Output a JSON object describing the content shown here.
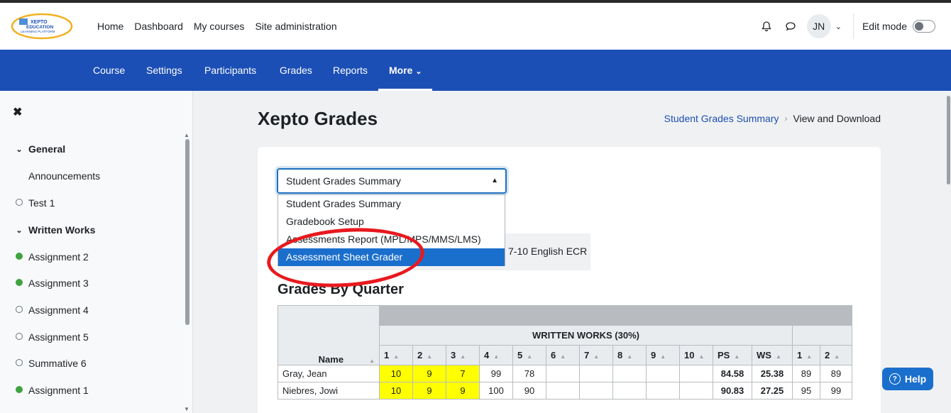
{
  "navbar": {
    "logo_text": "XEPTO EDUCATION LEARNING PLATFORM",
    "links": [
      "Home",
      "Dashboard",
      "My courses",
      "Site administration"
    ],
    "avatar_initials": "JN",
    "edit_mode_label": "Edit mode"
  },
  "secondary_nav": {
    "items": [
      "Course",
      "Settings",
      "Participants",
      "Grades",
      "Reports"
    ],
    "more_label": "More"
  },
  "drawer": {
    "items": [
      {
        "label": "General",
        "type": "section"
      },
      {
        "label": "Announcements",
        "type": "plain"
      },
      {
        "label": "Test 1",
        "type": "todo"
      },
      {
        "label": "Written Works",
        "type": "section"
      },
      {
        "label": "Assignment 2",
        "type": "done"
      },
      {
        "label": "Assignment 3",
        "type": "done"
      },
      {
        "label": "Assignment 4",
        "type": "todo"
      },
      {
        "label": "Assignment 5",
        "type": "todo"
      },
      {
        "label": "Summative 6",
        "type": "todo"
      },
      {
        "label": "Assignment 1",
        "type": "done"
      }
    ]
  },
  "page": {
    "title": "Xepto Grades",
    "breadcrumb": {
      "link": "Student Grades Summary",
      "current": "View and Download"
    }
  },
  "select": {
    "value": "Student Grades Summary",
    "options": [
      "Student Grades Summary",
      "Gradebook Setup",
      "Assessments Report (MPL/MPS/MMS/LMS)",
      "Assessment Sheet Grader"
    ],
    "highlighted_index": 3
  },
  "behind_text": "7-10 English ECR",
  "section_title": "Grades By Quarter",
  "table": {
    "group_header": "WRITTEN WORKS (30%)",
    "name_header": "Name",
    "columns": [
      "1",
      "2",
      "3",
      "4",
      "5",
      "6",
      "7",
      "8",
      "9",
      "10",
      "PS",
      "WS",
      "1",
      "2"
    ],
    "rows": [
      {
        "name": "Gray, Jean",
        "cells": [
          "10",
          "9",
          "7",
          "99",
          "78",
          "",
          "",
          "",
          "",
          "",
          "84.58",
          "25.38",
          "89",
          "89"
        ]
      },
      {
        "name": "Niebres, Jowi",
        "cells": [
          "10",
          "9",
          "9",
          "100",
          "90",
          "",
          "",
          "",
          "",
          "",
          "90.83",
          "27.25",
          "95",
          "99"
        ]
      }
    ]
  },
  "help_label": "Help"
}
